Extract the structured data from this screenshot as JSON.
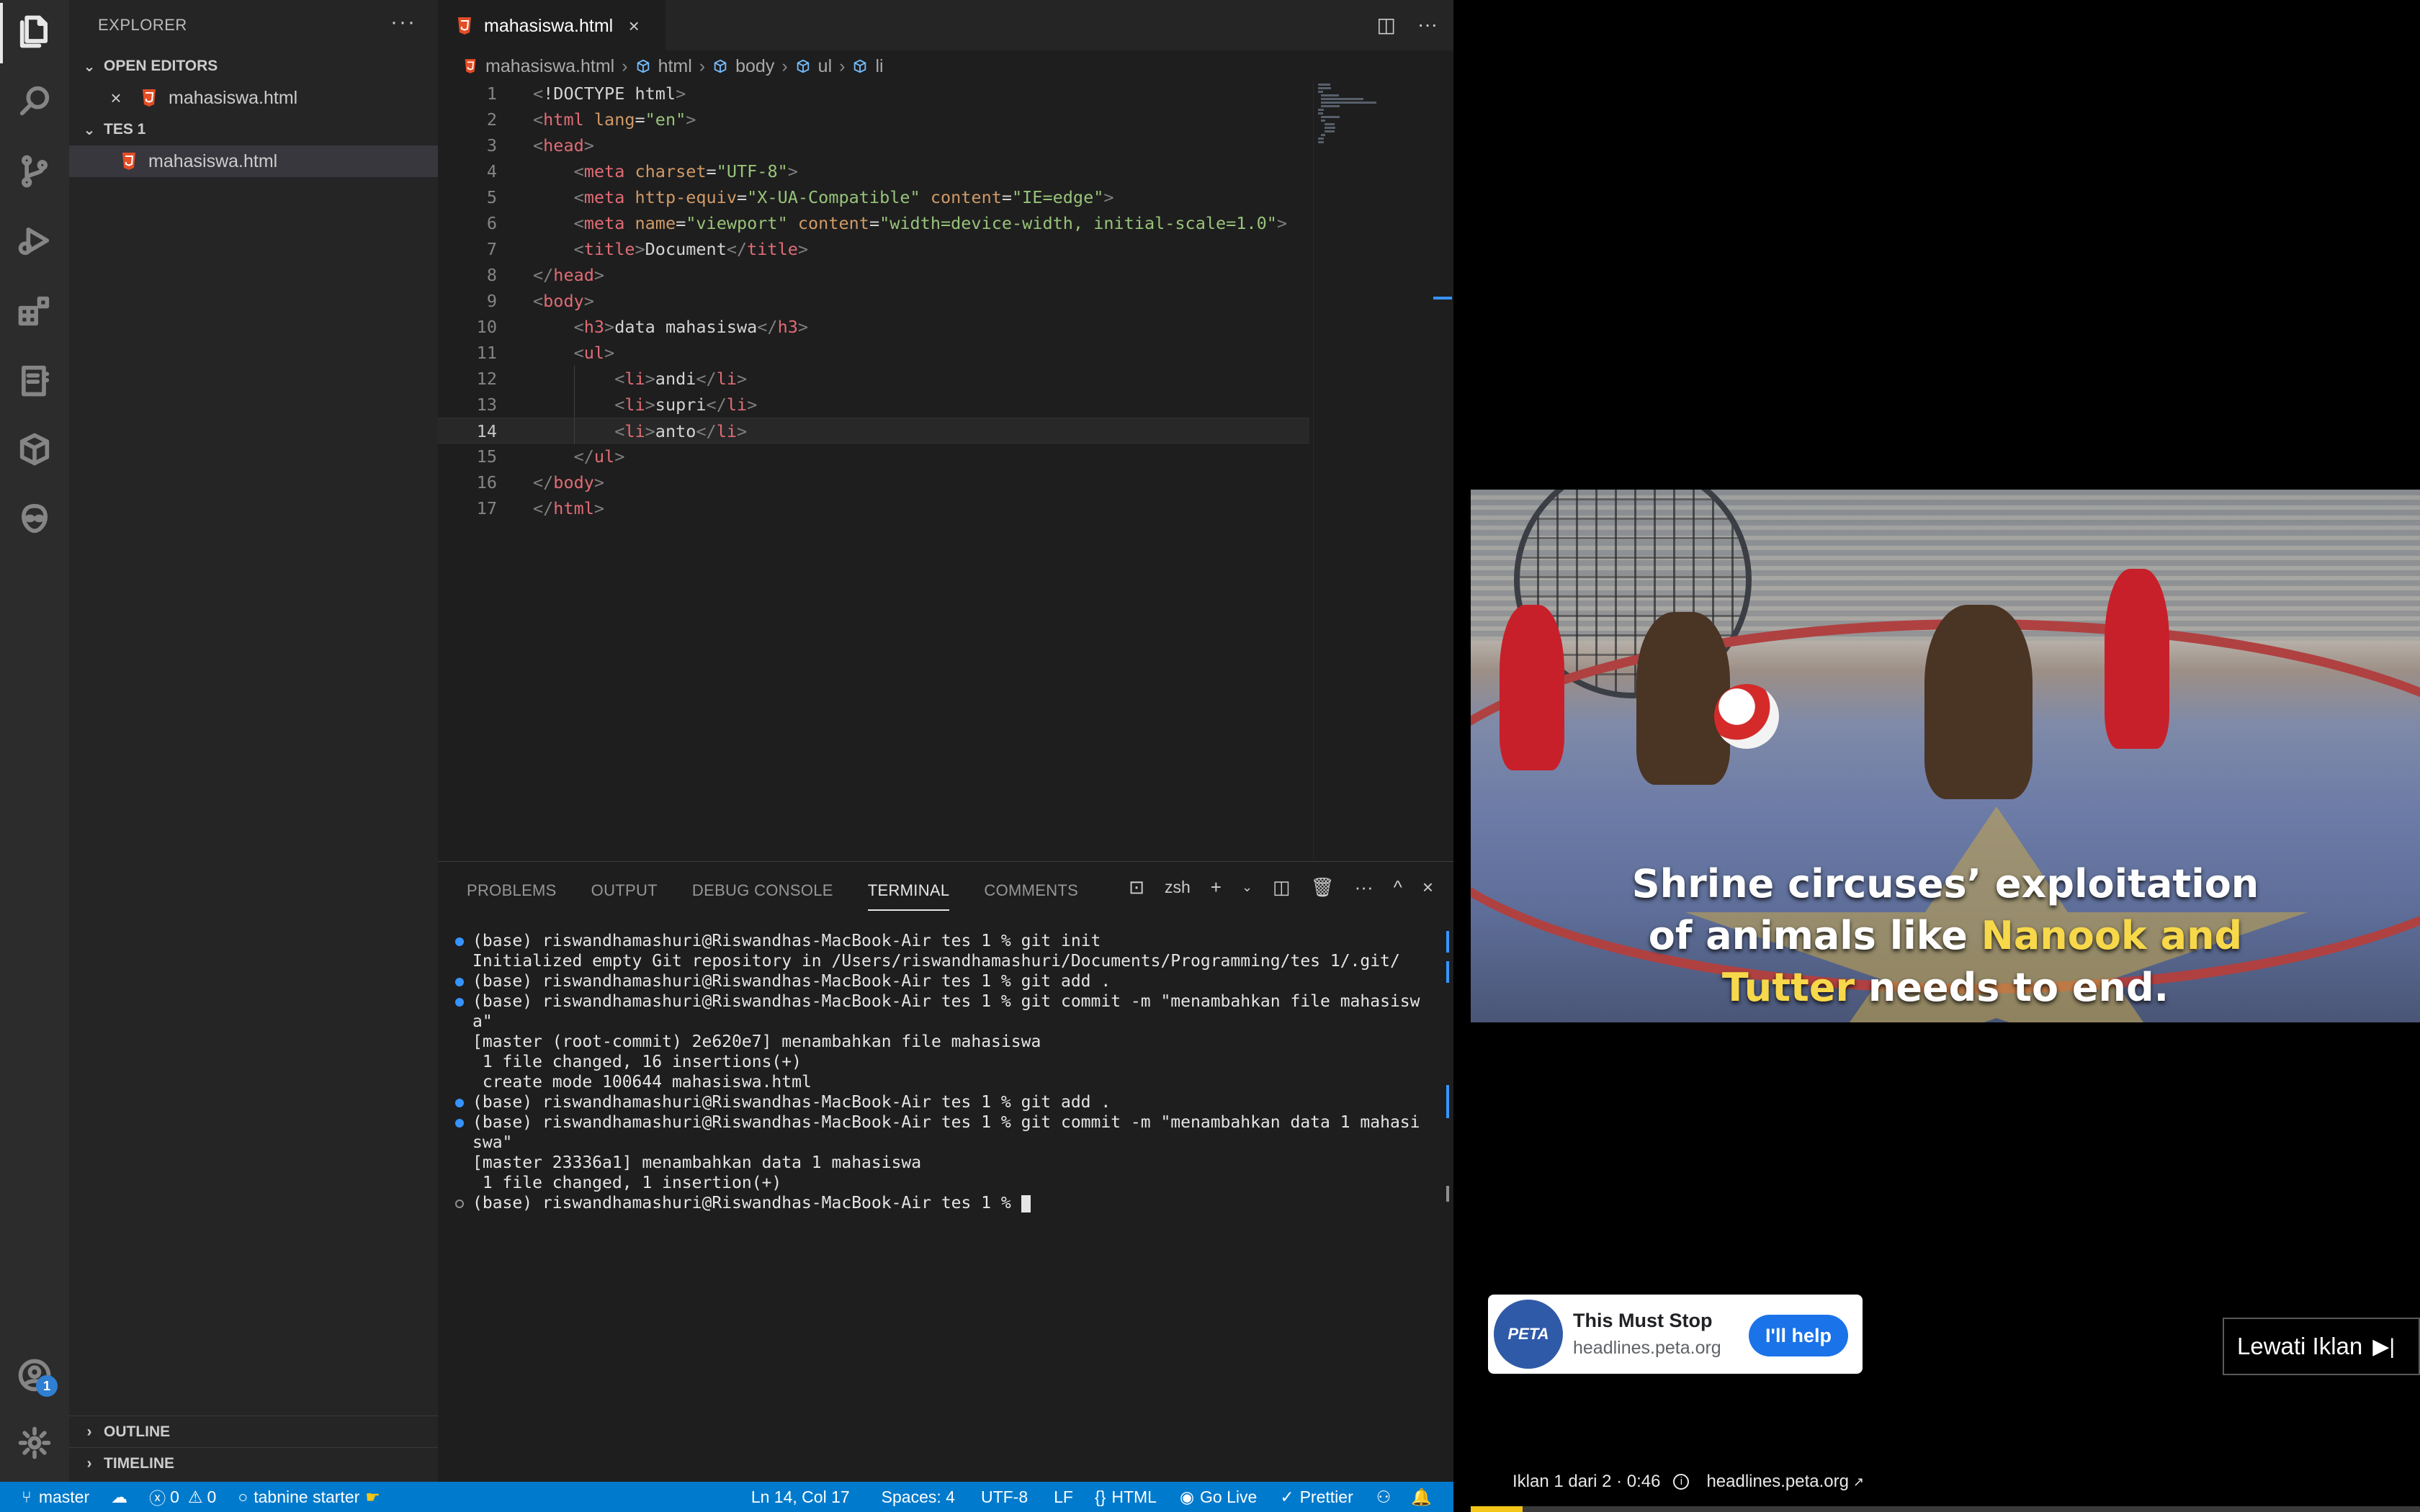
{
  "sidebar": {
    "title": "EXPLORER",
    "more": "···",
    "open_editors_label": "OPEN EDITORS",
    "open_editor_file": "mahasiswa.html",
    "folder_label": "TES 1",
    "folder_file": "mahasiswa.html",
    "outline_label": "OUTLINE",
    "timeline_label": "TIMELINE"
  },
  "activity_bar": {
    "icons": [
      "explorer-icon",
      "search-icon",
      "source-control-icon",
      "run-debug-icon",
      "extensions-icon",
      "notebook-icon",
      "remote-explorer-icon",
      "alien-icon",
      "account-icon",
      "manage-gear-icon"
    ],
    "account_badge": "1"
  },
  "editor": {
    "tab_label": "mahasiswa.html",
    "breadcrumb": [
      "mahasiswa.html",
      "html",
      "body",
      "ul",
      "li"
    ],
    "current_line": 14,
    "lines": [
      "<!DOCTYPE html>",
      "<html lang=\"en\">",
      "<head>",
      "    <meta charset=\"UTF-8\">",
      "    <meta http-equiv=\"X-UA-Compatible\" content=\"IE=edge\">",
      "    <meta name=\"viewport\" content=\"width=device-width, initial-scale=1.0\">",
      "    <title>Document</title>",
      "</head>",
      "<body>",
      "    <h3>data mahasiswa</h3>",
      "    <ul>",
      "        <li>andi</li>",
      "        <li>supri</li>",
      "        <li>anto</li>",
      "    </ul>",
      "</body>",
      "</html>"
    ]
  },
  "panel": {
    "tabs": [
      "PROBLEMS",
      "OUTPUT",
      "DEBUG CONSOLE",
      "TERMINAL",
      "COMMENTS"
    ],
    "active_tab": "TERMINAL",
    "shell": "zsh",
    "terminal_lines": [
      {
        "dot": "filled",
        "text": "(base) riswandhamashuri@Riswandhas-MacBook-Air tes 1 % git init"
      },
      {
        "dot": "",
        "text": "Initialized empty Git repository in /Users/riswandhamashuri/Documents/Programming/tes 1/.git/"
      },
      {
        "dot": "filled",
        "text": "(base) riswandhamashuri@Riswandhas-MacBook-Air tes 1 % git add ."
      },
      {
        "dot": "filled",
        "text": "(base) riswandhamashuri@Riswandhas-MacBook-Air tes 1 % git commit -m \"menambahkan file mahasisw"
      },
      {
        "dot": "",
        "text": "a\""
      },
      {
        "dot": "",
        "text": "[master (root-commit) 2e620e7] menambahkan file mahasiswa"
      },
      {
        "dot": "",
        "text": " 1 file changed, 16 insertions(+)"
      },
      {
        "dot": "",
        "text": " create mode 100644 mahasiswa.html"
      },
      {
        "dot": "filled",
        "text": "(base) riswandhamashuri@Riswandhas-MacBook-Air tes 1 % git add ."
      },
      {
        "dot": "filled",
        "text": "(base) riswandhamashuri@Riswandhas-MacBook-Air tes 1 % git commit -m \"menambahkan data 1 mahasi"
      },
      {
        "dot": "",
        "text": "swa\""
      },
      {
        "dot": "",
        "text": "[master 23336a1] menambahkan data 1 mahasiswa"
      },
      {
        "dot": "",
        "text": " 1 file changed, 1 insertion(+)"
      },
      {
        "dot": "hollow",
        "text": "(base) riswandhamashuri@Riswandhas-MacBook-Air tes 1 % "
      }
    ]
  },
  "status_bar": {
    "branch": "master",
    "errors": "0",
    "warnings": "0",
    "tabnine": "tabnine starter",
    "cursor_pos": "Ln 14, Col 17",
    "spaces": "Spaces: 4",
    "encoding": "UTF-8",
    "eol": "LF",
    "language": "HTML",
    "go_live": "Go Live",
    "prettier": "Prettier"
  },
  "ad": {
    "caption_line1": "Shrine circuses’ exploitation",
    "caption_line2a": "of animals like ",
    "caption_line2b": "Nanook and",
    "caption_line3a": "Tutter",
    "caption_line3b": " needs to end.",
    "card_title": "This Must Stop",
    "card_url": "headlines.peta.org",
    "logo_text": "PETA",
    "cta_label": "I'll help",
    "skip_label": "Lewati Iklan",
    "info_text": "Iklan 1 dari 2 · 0:46",
    "info_link": "headlines.peta.org",
    "progress": 0.055,
    "highlight_color": "#f7d84a"
  }
}
